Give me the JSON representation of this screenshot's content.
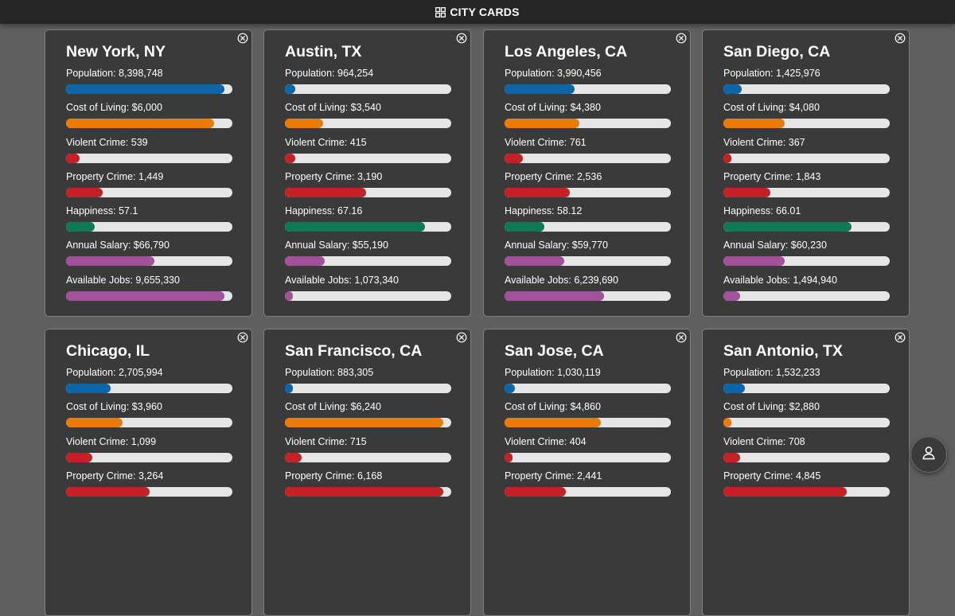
{
  "app": {
    "title": "CITY CARDS",
    "icon": "grid-icon"
  },
  "colors": {
    "population": "#0a66a8",
    "cost": "#ec7a07",
    "violent": "#c42025",
    "property": "#c42025",
    "happiness": "#0d7a55",
    "salary": "#a2529a",
    "jobs": "#a2529a"
  },
  "cards": [
    {
      "name": "New York, NY",
      "stats": [
        {
          "label": "Population: 8,398,748",
          "color": "population",
          "fill": 0.95
        },
        {
          "label": "Cost of Living: $6,000",
          "color": "cost",
          "fill": 0.89
        },
        {
          "label": "Violent Crime: 539",
          "color": "violent",
          "fill": 0.08
        },
        {
          "label": "Property Crime: 1,449",
          "color": "property",
          "fill": 0.22
        },
        {
          "label": "Happiness: 57.1",
          "color": "happiness",
          "fill": 0.17
        },
        {
          "label": "Annual Salary: $66,790",
          "color": "salary",
          "fill": 0.53
        },
        {
          "label": "Available Jobs: 9,655,330",
          "color": "jobs",
          "fill": 0.95
        }
      ]
    },
    {
      "name": "Austin, TX",
      "stats": [
        {
          "label": "Population: 964,254",
          "color": "population",
          "fill": 0.06
        },
        {
          "label": "Cost of Living: $3,540",
          "color": "cost",
          "fill": 0.23
        },
        {
          "label": "Violent Crime: 415",
          "color": "violent",
          "fill": 0.06
        },
        {
          "label": "Property Crime: 3,190",
          "color": "property",
          "fill": 0.49
        },
        {
          "label": "Happiness: 67.16",
          "color": "happiness",
          "fill": 0.84
        },
        {
          "label": "Annual Salary: $55,190",
          "color": "salary",
          "fill": 0.24
        },
        {
          "label": "Available Jobs: 1,073,340",
          "color": "jobs",
          "fill": 0.05
        }
      ]
    },
    {
      "name": "Los Angeles, CA",
      "stats": [
        {
          "label": "Population: 3,990,456",
          "color": "population",
          "fill": 0.42
        },
        {
          "label": "Cost of Living: $4,380",
          "color": "cost",
          "fill": 0.45
        },
        {
          "label": "Violent Crime: 761",
          "color": "violent",
          "fill": 0.11
        },
        {
          "label": "Property Crime: 2,536",
          "color": "property",
          "fill": 0.39
        },
        {
          "label": "Happiness: 58.12",
          "color": "happiness",
          "fill": 0.24
        },
        {
          "label": "Annual Salary: $59,770",
          "color": "salary",
          "fill": 0.36
        },
        {
          "label": "Available Jobs: 6,239,690",
          "color": "jobs",
          "fill": 0.6
        }
      ]
    },
    {
      "name": "San Diego, CA",
      "stats": [
        {
          "label": "Population: 1,425,976",
          "color": "population",
          "fill": 0.11
        },
        {
          "label": "Cost of Living: $4,080",
          "color": "cost",
          "fill": 0.37
        },
        {
          "label": "Violent Crime: 367",
          "color": "violent",
          "fill": 0.05
        },
        {
          "label": "Property Crime: 1,843",
          "color": "property",
          "fill": 0.28
        },
        {
          "label": "Happiness: 66.01",
          "color": "happiness",
          "fill": 0.77
        },
        {
          "label": "Annual Salary: $60,230",
          "color": "salary",
          "fill": 0.37
        },
        {
          "label": "Available Jobs: 1,494,940",
          "color": "jobs",
          "fill": 0.1
        }
      ]
    },
    {
      "name": "Chicago, IL",
      "stats": [
        {
          "label": "Population: 2,705,994",
          "color": "population",
          "fill": 0.27
        },
        {
          "label": "Cost of Living: $3,960",
          "color": "cost",
          "fill": 0.34
        },
        {
          "label": "Violent Crime: 1,099",
          "color": "violent",
          "fill": 0.16
        },
        {
          "label": "Property Crime: 3,264",
          "color": "property",
          "fill": 0.5
        }
      ]
    },
    {
      "name": "San Francisco, CA",
      "stats": [
        {
          "label": "Population: 883,305",
          "color": "population",
          "fill": 0.05
        },
        {
          "label": "Cost of Living: $6,240",
          "color": "cost",
          "fill": 0.95
        },
        {
          "label": "Violent Crime: 715",
          "color": "violent",
          "fill": 0.1
        },
        {
          "label": "Property Crime: 6,168",
          "color": "property",
          "fill": 0.95
        }
      ]
    },
    {
      "name": "San Jose, CA",
      "stats": [
        {
          "label": "Population: 1,030,119",
          "color": "population",
          "fill": 0.06
        },
        {
          "label": "Cost of Living: $4,860",
          "color": "cost",
          "fill": 0.58
        },
        {
          "label": "Violent Crime: 404",
          "color": "violent",
          "fill": 0.05
        },
        {
          "label": "Property Crime: 2,441",
          "color": "property",
          "fill": 0.37
        }
      ]
    },
    {
      "name": "San Antonio, TX",
      "stats": [
        {
          "label": "Population: 1,532,233",
          "color": "population",
          "fill": 0.13
        },
        {
          "label": "Cost of Living: $2,880",
          "color": "cost",
          "fill": 0.05
        },
        {
          "label": "Violent Crime: 708",
          "color": "violent",
          "fill": 0.1
        },
        {
          "label": "Property Crime: 4,845",
          "color": "property",
          "fill": 0.74
        }
      ]
    }
  ],
  "fab": {
    "icon": "user-icon"
  }
}
